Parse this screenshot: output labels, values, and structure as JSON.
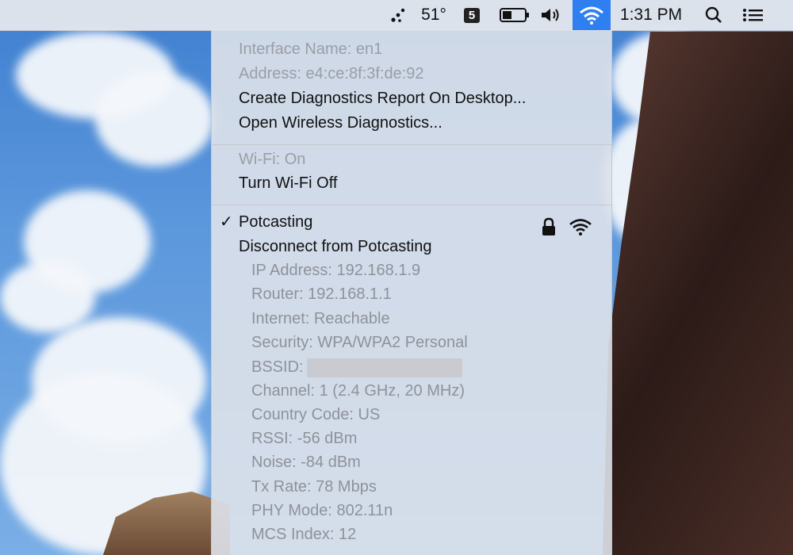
{
  "menubar": {
    "weather_temp": "51°",
    "badge_number": "5",
    "time": "1:31 PM",
    "icons": [
      "dots-icon",
      "badge-icon",
      "battery-icon",
      "volume-icon",
      "wifi-icon",
      "search-icon",
      "list-icon"
    ],
    "wifi_highlight_color": "#2f7ff0"
  },
  "wifi_menu": {
    "interface_name": "Interface Name: en1",
    "address": "Address: e4:ce:8f:3f:de:92",
    "create_report": "Create Diagnostics Report On Desktop...",
    "open_diagnostics": "Open Wireless Diagnostics...",
    "wifi_status": "Wi-Fi: On",
    "turn_off": "Turn Wi-Fi Off",
    "network": {
      "name": "Potcasting",
      "checkmark": "✓",
      "disconnect": "Disconnect from Potcasting",
      "details": {
        "ip": "IP Address: 192.168.1.9",
        "router": "Router: 192.168.1.1",
        "internet": "Internet: Reachable",
        "security": "Security: WPA/WPA2 Personal",
        "bssid_label": "BSSID:",
        "channel": "Channel: 1 (2.4 GHz, 20 MHz)",
        "country": "Country Code: US",
        "rssi": "RSSI: -56 dBm",
        "noise": "Noise: -84 dBm",
        "tx_rate": "Tx Rate: 78 Mbps",
        "phy_mode": "PHY Mode: 802.11n",
        "mcs_index": "MCS Index: 12"
      }
    }
  }
}
